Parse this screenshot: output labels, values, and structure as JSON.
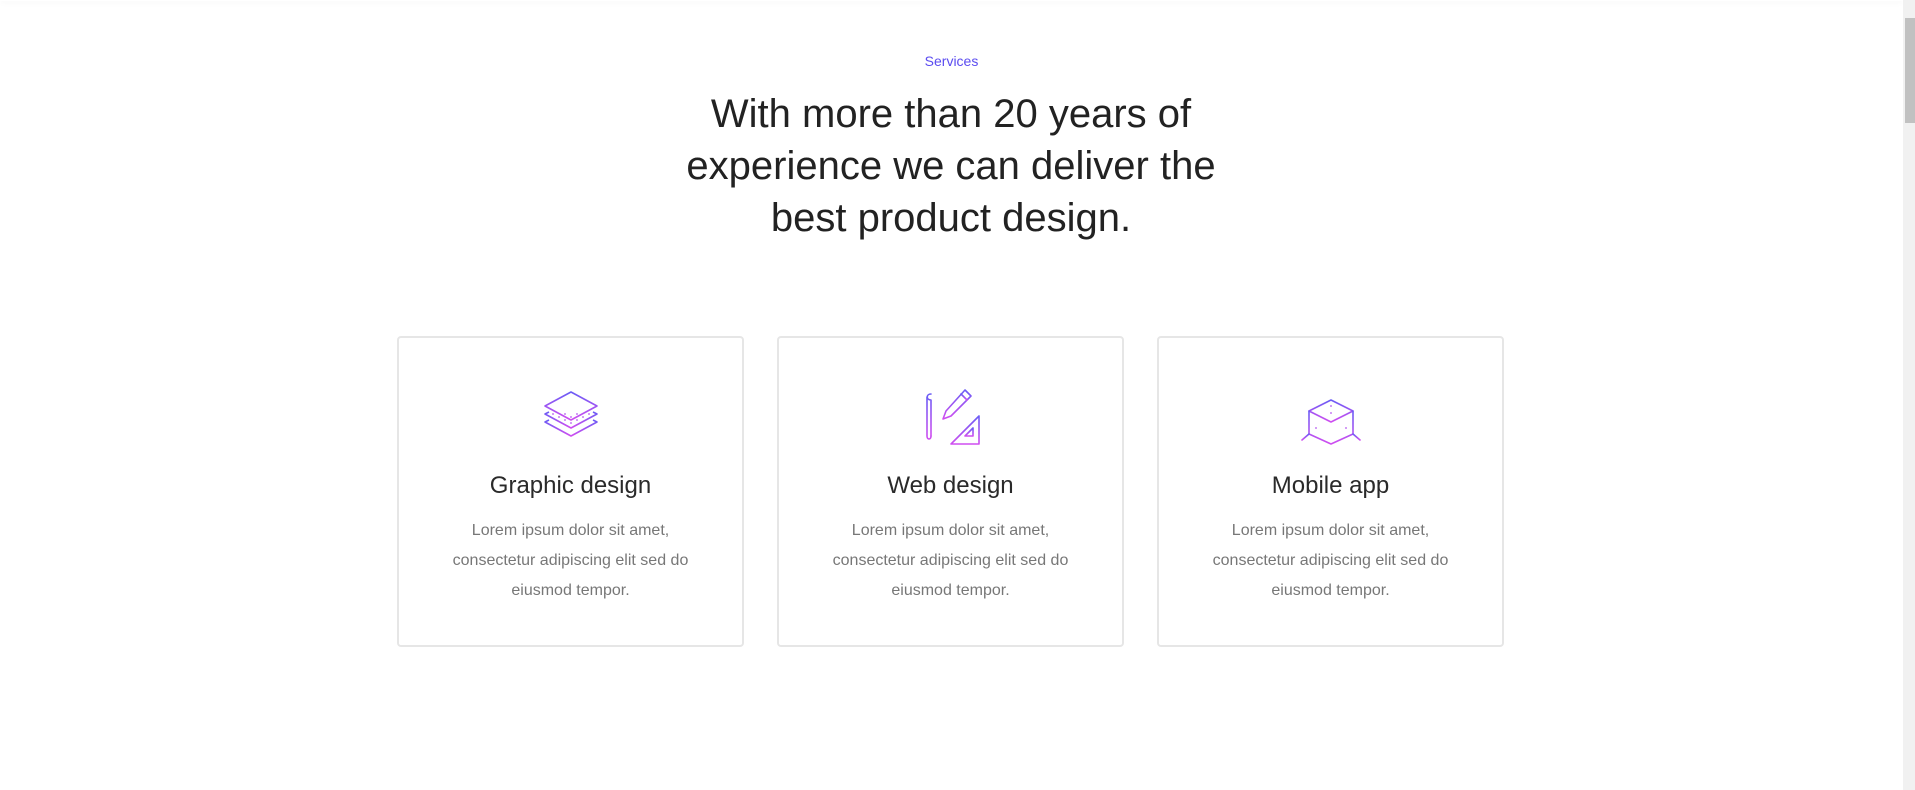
{
  "section": {
    "eyebrow": "Services",
    "headline": "With more than 20 years of experience we can deliver the best product design."
  },
  "services": [
    {
      "title": "Graphic design",
      "description": "Lorem ipsum dolor sit amet, consectetur adipiscing elit sed do eiusmod tempor.",
      "icon": "layers-icon"
    },
    {
      "title": "Web design",
      "description": "Lorem ipsum dolor sit amet, consectetur adipiscing elit sed do eiusmod tempor.",
      "icon": "blueprint-pencil-icon"
    },
    {
      "title": "Mobile app",
      "description": "Lorem ipsum dolor sit amet, consectetur adipiscing elit sed do eiusmod tempor.",
      "icon": "cube-icon"
    }
  ],
  "colors": {
    "accent": "#5b4cf0",
    "icon_gradient_start": "#6a5cf5",
    "icon_gradient_end": "#d04ef0",
    "card_border": "#e6e6e6"
  }
}
